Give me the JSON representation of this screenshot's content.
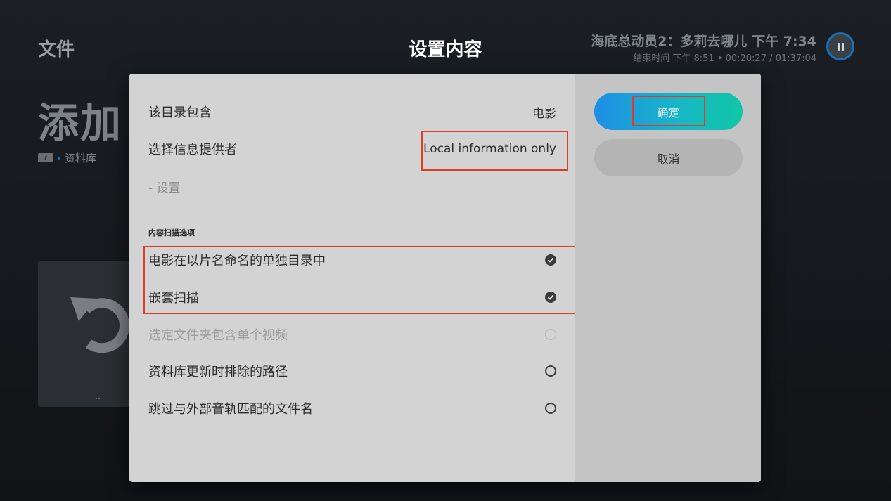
{
  "background": {
    "section_title": "文件",
    "header_title": "设置内容",
    "now_playing": {
      "title": "海底总动员2：多莉去哪儿 下午 7:34",
      "subtitle": "结束时间 下午 8:51 • 00:20:27 / 01:37:04"
    },
    "page_heading": "添加",
    "breadcrumb_label": "资料库",
    "tile_label": ".."
  },
  "dialog": {
    "rows": {
      "content_type": {
        "label": "该目录包含",
        "value": "电影"
      },
      "info_provider": {
        "label": "选择信息提供者",
        "value": "Local information only"
      },
      "settings": {
        "label": "- 设置"
      }
    },
    "scan_section_title": "内容扫描选项",
    "options": [
      {
        "label": "电影在以片名命名的单独目录中",
        "checked": true,
        "enabled": true
      },
      {
        "label": "嵌套扫描",
        "checked": true,
        "enabled": true
      },
      {
        "label": "选定文件夹包含单个视频",
        "checked": false,
        "enabled": false
      },
      {
        "label": "资料库更新时排除的路径",
        "checked": false,
        "enabled": true
      },
      {
        "label": "跳过与外部音轨匹配的文件名",
        "checked": false,
        "enabled": true
      }
    ],
    "buttons": {
      "ok": "确定",
      "cancel": "取消"
    }
  },
  "colors": {
    "highlight": "#e03b24",
    "ok_button_start": "#1f8ee6",
    "ok_button_end": "#10c6a6"
  }
}
